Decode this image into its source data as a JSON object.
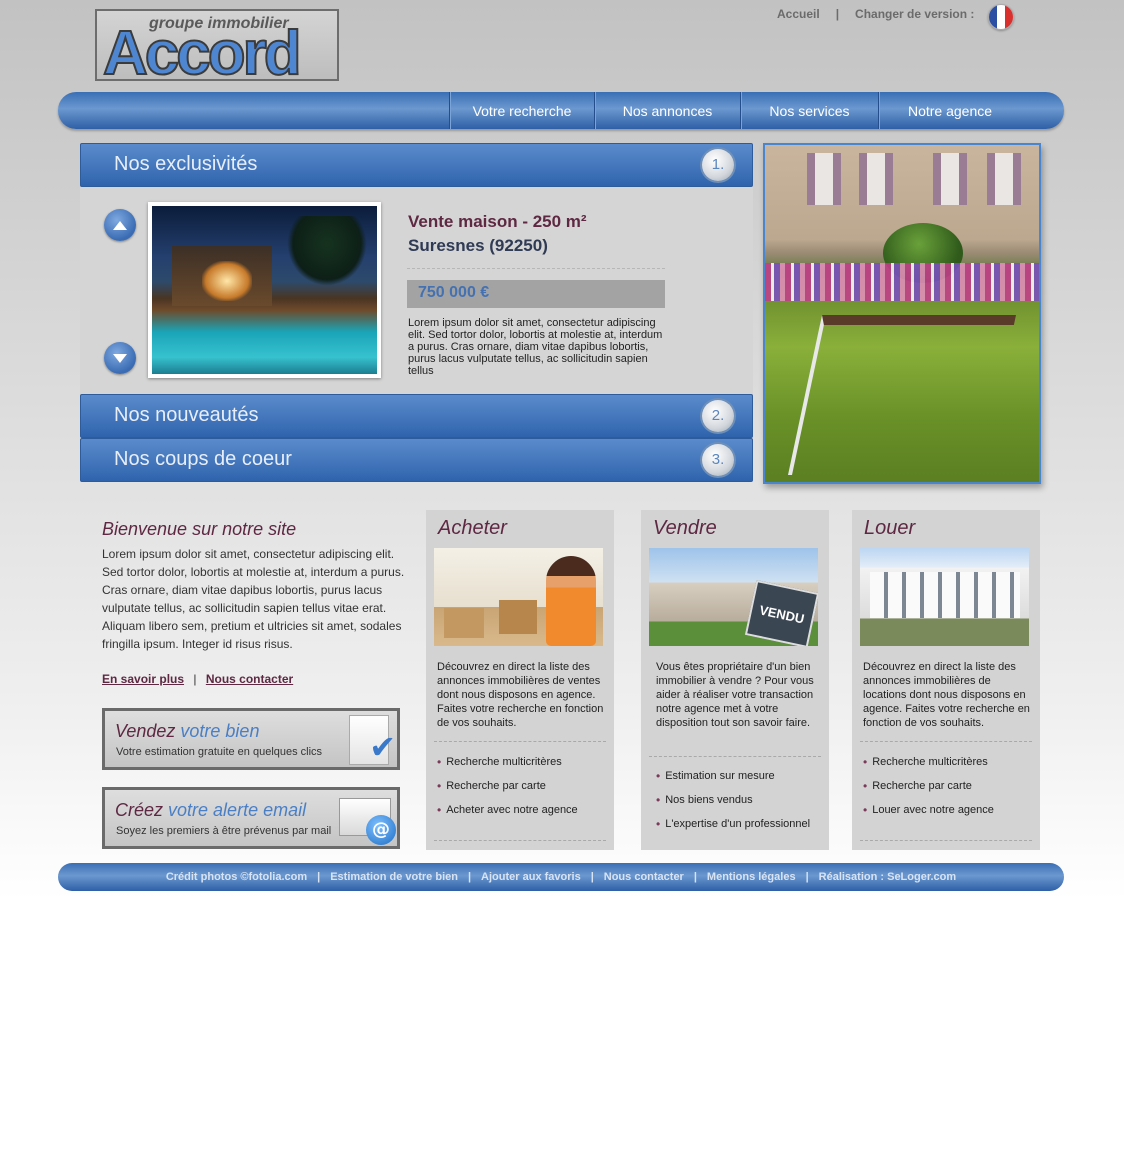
{
  "header": {
    "logo_top": "groupe immobilier",
    "logo_main": "Accord",
    "links": [
      "Accueil",
      "Changer de version :"
    ],
    "flag_colors": [
      "#2b4fa3",
      "#ffffff",
      "#d9302e"
    ]
  },
  "nav": {
    "items": [
      "Votre recherche",
      "Nos annonces",
      "Nos services",
      "Notre agence"
    ]
  },
  "accordion": {
    "sections": [
      {
        "title": "Nos exclusivités",
        "num": "1."
      },
      {
        "title": "Nos nouveautés",
        "num": "2."
      },
      {
        "title": "Nos coups de coeur",
        "num": "3."
      }
    ],
    "featured": {
      "title": "Vente maison - 250 m²",
      "location": "Suresnes (92250)",
      "price": "750 000 €",
      "description": "Lorem ipsum dolor sit amet, consectetur adipiscing elit. Sed tortor dolor, lobortis at molestie at, interdum a purus. Cras ornare, diam vitae dapibus lobortis, purus lacus vulputate tellus, ac sollicitudin sapien tellus"
    }
  },
  "welcome": {
    "title": "Bienvenue sur notre site",
    "text": "Lorem ipsum dolor sit amet, consectetur adipiscing elit. Sed tortor dolor, lobortis at molestie at, interdum a purus. Cras ornare, diam vitae dapibus lobortis, purus lacus vulputate tellus, ac sollicitudin sapien tellus vitae erat. Aliquam libero sem, pretium et ultricies sit amet, sodales fringilla ipsum. Integer id risus risus.",
    "link_more": "En savoir plus",
    "link_sep": "|",
    "link_contact": "Nous contacter"
  },
  "promos": [
    {
      "title_a": "Vendez",
      "title_b": "votre bien",
      "subtitle": "Votre estimation gratuite en quelques clics"
    },
    {
      "title_a": "Créez",
      "title_b": "votre alerte email",
      "subtitle": "Soyez les premiers à être prévenus par mail"
    }
  ],
  "cards": [
    {
      "title": "Acheter",
      "description": "Découvrez en direct la liste des annonces immobilières de ventes dont nous disposons en agence. Faites votre recherche en fonction de vos souhaits.",
      "links": [
        "Recherche multicritères",
        "Recherche par carte",
        "Acheter avec notre agence"
      ]
    },
    {
      "title": "Vendre",
      "description": "Vous êtes propriétaire d'un bien immobilier à vendre ? Pour vous aider à réaliser votre transaction notre agence met à votre disposition tout son savoir faire.",
      "sign": "VENDU",
      "links": [
        "Estimation sur mesure",
        "Nos biens vendus",
        "L'expertise d'un professionnel"
      ]
    },
    {
      "title": "Louer",
      "description": "Découvrez en direct la liste des annonces immobilières de locations dont nous disposons en agence. Faites votre recherche en fonction de vos souhaits.",
      "links": [
        "Recherche multicritères",
        "Recherche par carte",
        "Louer avec notre agence"
      ]
    }
  ],
  "footer": {
    "links": [
      "Crédit photos ©fotolia.com",
      "Estimation de votre bien",
      "Ajouter aux favoris",
      "Nous contacter",
      "Mentions légales",
      "Réalisation : SeLoger.com"
    ],
    "sep": "|"
  }
}
